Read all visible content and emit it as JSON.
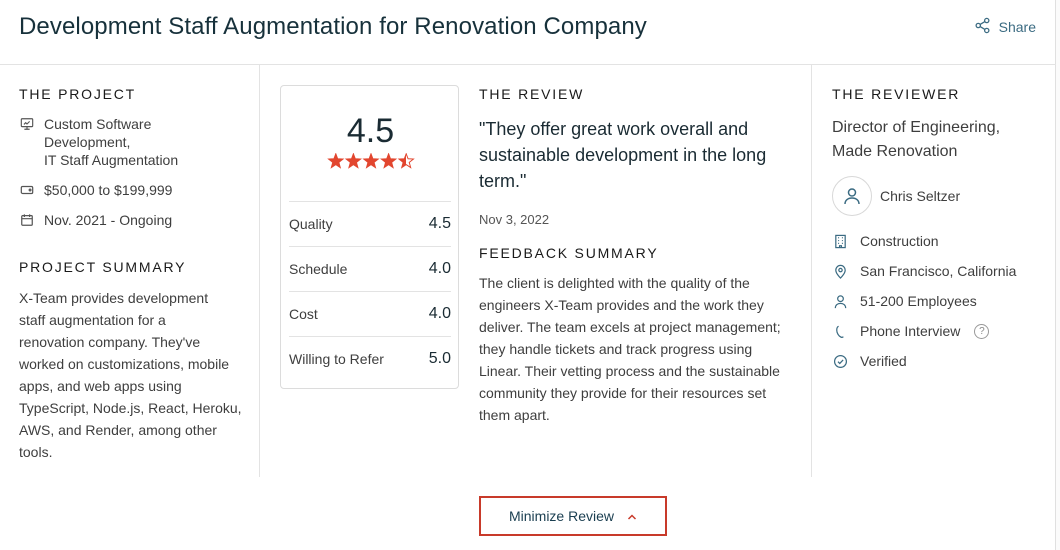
{
  "header": {
    "title": "Development Staff Augmentation for Renovation Company",
    "share_label": "Share"
  },
  "project": {
    "label": "THE PROJECT",
    "service_lines": [
      "Custom Software",
      "Development,",
      "IT Staff Augmentation"
    ],
    "budget": "$50,000 to $199,999",
    "dates": "Nov. 2021 - Ongoing",
    "summary_label": "PROJECT SUMMARY",
    "summary_lines": [
      "X-Team provides development",
      "staff augmentation for a",
      "renovation company. They've",
      "worked on customizations, mobile",
      "apps, and web apps using",
      "TypeScript, Node.js, React, Heroku,",
      "AWS, and Render, among other",
      "tools."
    ]
  },
  "rating": {
    "overall": "4.5",
    "stars": 4.5,
    "star_color": "#e2462f",
    "scores": [
      {
        "label": "Quality",
        "value": "4.5"
      },
      {
        "label": "Schedule",
        "value": "4.0"
      },
      {
        "label": "Cost",
        "value": "4.0"
      },
      {
        "label": "Willing to Refer",
        "value": "5.0"
      }
    ]
  },
  "review": {
    "label": "THE REVIEW",
    "quote_lines": [
      "\"They offer great work overall and",
      "sustainable development in the long",
      "term.\""
    ],
    "date": "Nov 3, 2022",
    "feedback_label": "FEEDBACK SUMMARY",
    "feedback_lines": [
      "The client is delighted with the quality of the",
      "engineers X-Team provides and the work they",
      "deliver. The team excels at project management;",
      "they handle tickets and track progress using",
      "Linear. Their vetting process and the sustainable",
      "community they provide for their resources set",
      "them apart."
    ]
  },
  "reviewer": {
    "label": "THE REVIEWER",
    "role_lines": [
      "Director of Engineering,",
      "Made Renovation"
    ],
    "name": "Chris Seltzer",
    "industry": "Construction",
    "location": "San Francisco, California",
    "size": "51-200 Employees",
    "interview": "Phone Interview",
    "help_mark": "?",
    "verified": "Verified"
  },
  "actions": {
    "minimize_label": "Minimize Review"
  },
  "colors": {
    "accent": "#c83a2a",
    "link": "#3b6b82",
    "title": "#17313b"
  }
}
